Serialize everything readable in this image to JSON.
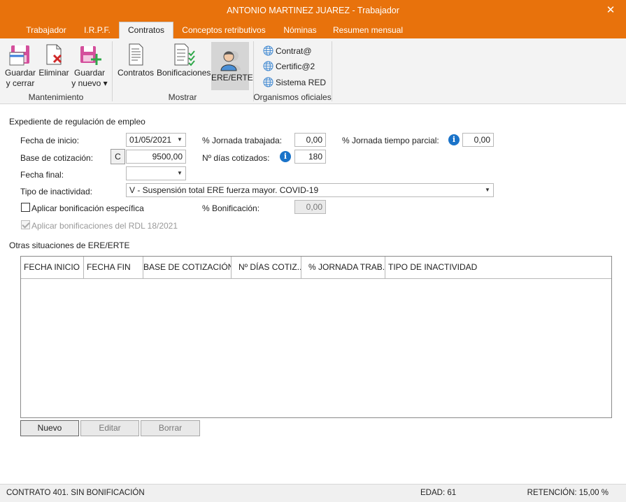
{
  "window": {
    "title": "ANTONIO MARTINEZ JUAREZ - Trabajador",
    "close_glyph": "✕"
  },
  "tabs": [
    {
      "label": "Trabajador"
    },
    {
      "label": "I.R.P.F."
    },
    {
      "label": "Contratos"
    },
    {
      "label": "Conceptos retributivos"
    },
    {
      "label": "Nóminas"
    },
    {
      "label": "Resumen mensual"
    }
  ],
  "ribbon": {
    "mantenimiento": {
      "label": "Mantenimiento",
      "guardar_cerrar": [
        "Guardar",
        "y cerrar"
      ],
      "eliminar": "Eliminar",
      "guardar_nuevo": [
        "Guardar",
        "y nuevo ▾"
      ]
    },
    "mostrar": {
      "label": "Mostrar",
      "contratos": "Contratos",
      "bonificaciones": "Bonificaciones",
      "ere_erte": "ERE/ERTE"
    },
    "organismos": {
      "label": "Organismos oficiales",
      "contrata": "Contrat@",
      "certifica": "Certific@2",
      "sistema_red": "Sistema RED"
    }
  },
  "form": {
    "section_title": "Expediente de regulación de empleo",
    "fecha_inicio": {
      "label": "Fecha de inicio:",
      "value": "01/05/2021"
    },
    "jornada_trabajada": {
      "label": "% Jornada trabajada:",
      "value": "0,00"
    },
    "jornada_parcial": {
      "label": "% Jornada tiempo parcial:",
      "value": "0,00"
    },
    "base_cotizacion": {
      "label": "Base de cotización:",
      "button": "C",
      "value": "9500,00"
    },
    "dias_cotizados": {
      "label": "Nº días cotizados:",
      "value": "180"
    },
    "fecha_final": {
      "label": "Fecha final:",
      "value": ""
    },
    "tipo_inactividad": {
      "label": "Tipo de inactividad:",
      "value": "V - Suspensión total ERE fuerza mayor. COVID-19"
    },
    "bonif_especifica": {
      "label": "Aplicar bonificación específica",
      "checked": false
    },
    "porc_bonificacion": {
      "label": "% Bonificación:",
      "value": "0,00"
    },
    "bonif_rdl": {
      "label": "Aplicar bonificaciones del RDL 18/2021",
      "checked": true
    }
  },
  "otras": {
    "title": "Otras situaciones de ERE/ERTE",
    "columns": [
      "FECHA INICIO",
      "FECHA FIN",
      "BASE DE COTIZACIÓN",
      "Nº DÍAS COTIZ...",
      "% JORNADA TRAB...",
      "TIPO DE INACTIVIDAD"
    ],
    "rows": [],
    "buttons": {
      "nuevo": "Nuevo",
      "editar": "Editar",
      "borrar": "Borrar"
    }
  },
  "status": {
    "contrato": "CONTRATO 401.  SIN BONIFICACIÓN",
    "edad": "EDAD: 61",
    "retencion": "RETENCIÓN: 15,00 %"
  },
  "colors": {
    "accent": "#e8720c",
    "info": "#1a73c9"
  }
}
